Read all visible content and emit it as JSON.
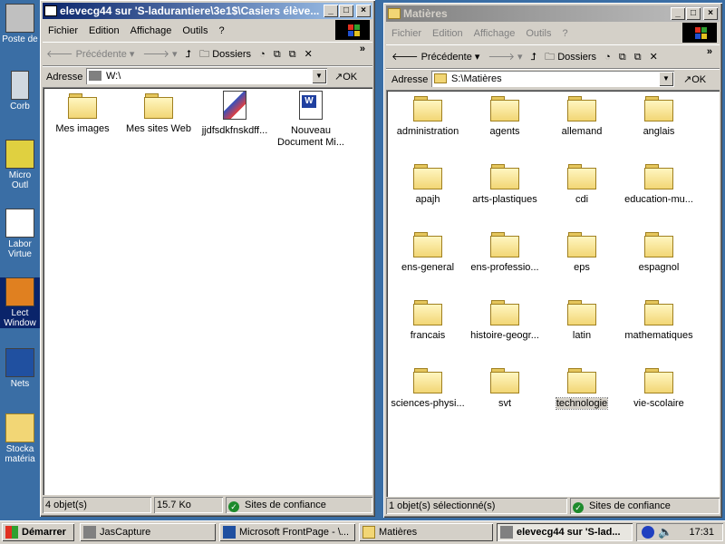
{
  "desktop": {
    "icons": [
      {
        "label": "Poste de travail",
        "icon": "computer-icon"
      },
      {
        "label": "Corbeille",
        "icon": "recycle-bin-icon"
      },
      {
        "label": "Microsoft Outlook",
        "icon": "outlook-icon"
      },
      {
        "label": "Laboratoire Virtuel",
        "icon": "shortcut-icon"
      },
      {
        "label": "Lecteur Windows",
        "icon": "media-player-icon"
      },
      {
        "label": "Netscape",
        "icon": "netscape-icon"
      },
      {
        "label": "Stockage matériel",
        "icon": "folder-shortcut-icon"
      }
    ],
    "visible_labels": [
      "Poste de",
      "Corb",
      "Micro",
      "Outl",
      "Labor",
      "Virtue",
      "Lect",
      "Window",
      "Nets",
      "Stocka",
      "matéria"
    ]
  },
  "window_left": {
    "title": "elevecg44 sur 'S-ladurantiere\\3e1$\\Casiers élève...",
    "menu": [
      "Fichier",
      "Edition",
      "Affichage",
      "Outils",
      "?"
    ],
    "toolbar": {
      "back": "Précédente",
      "folders": "Dossiers",
      "more": "»"
    },
    "address_label": "Adresse",
    "address_value": "W:\\",
    "go": "OK",
    "items": [
      "Mes images",
      "Mes sites Web",
      "jjdfsdkfnskdff...",
      "Nouveau Document Mi..."
    ],
    "status": {
      "count": "4 objet(s)",
      "size": "15.7 Ko",
      "zone": "Sites de confiance"
    }
  },
  "window_right": {
    "title": "Matières",
    "menu": [
      "Fichier",
      "Edition",
      "Affichage",
      "Outils",
      "?"
    ],
    "toolbar": {
      "back": "Précédente",
      "folders": "Dossiers",
      "more": "»"
    },
    "address_label": "Adresse",
    "address_value": "S:\\Matières",
    "go": "OK",
    "folders": [
      "administration",
      "agents",
      "allemand",
      "anglais",
      "apajh",
      "arts-plastiques",
      "cdi",
      "education-mu...",
      "ens-general",
      "ens-professio...",
      "eps",
      "espagnol",
      "francais",
      "histoire-geogr...",
      "latin",
      "mathematiques",
      "sciences-physi...",
      "svt",
      "technologie",
      "vie-scolaire"
    ],
    "selected": "technologie",
    "status": {
      "selection": "1 objet(s) sélectionné(s)",
      "zone": "Sites de confiance"
    }
  },
  "taskbar": {
    "start": "Démarrer",
    "tasks": [
      "JasCapture",
      "Microsoft FrontPage - \\...",
      "Matières",
      "elevecg44 sur 'S-lad..."
    ],
    "clock": "17:31"
  },
  "colors": {
    "desktop": "#3a6ea5",
    "active_title": "#0a246a",
    "folder": "#f2d675"
  }
}
